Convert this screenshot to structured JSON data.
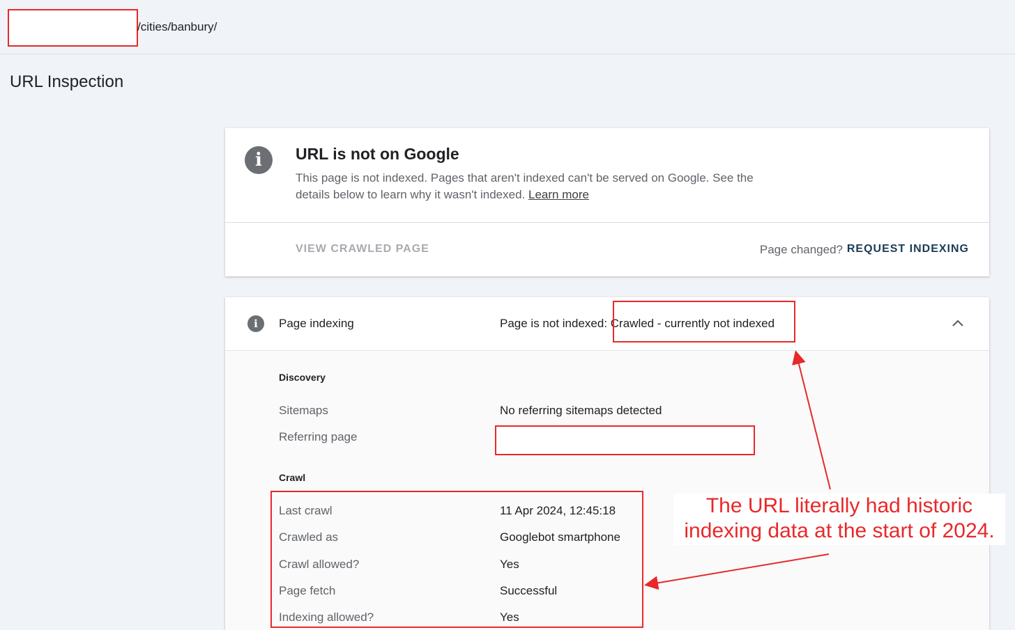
{
  "header": {
    "url_suffix": "/cities/banbury/",
    "page_title": "URL Inspection"
  },
  "status_card": {
    "info_icon": "info-icon",
    "title": "URL is not on Google",
    "description": "This page is not indexed. Pages that aren't indexed can't be served on Google. See the details below to learn why it wasn't indexed.",
    "learn_more": "Learn more",
    "view_crawled": "VIEW CRAWLED PAGE",
    "page_changed": "Page changed?",
    "request_indexing": "REQUEST INDEXING"
  },
  "indexing_card": {
    "info_icon": "info-icon",
    "label": "Page indexing",
    "status_prefix": "Page is not indexed: ",
    "status_reason": "Crawled - currently not indexed",
    "chevron_icon": "chevron-up-icon",
    "discovery": {
      "heading": "Discovery",
      "rows": [
        {
          "label": "Sitemaps",
          "value": "No referring sitemaps detected"
        },
        {
          "label": "Referring page",
          "value": ""
        }
      ]
    },
    "crawl": {
      "heading": "Crawl",
      "rows": [
        {
          "label": "Last crawl",
          "value": "11 Apr 2024, 12:45:18"
        },
        {
          "label": "Crawled as",
          "value": "Googlebot smartphone"
        },
        {
          "label": "Crawl allowed?",
          "value": "Yes"
        },
        {
          "label": "Page fetch",
          "value": "Successful"
        },
        {
          "label": "Indexing allowed?",
          "value": "Yes"
        }
      ]
    }
  },
  "annotation": {
    "line1": "The URL literally had historic",
    "line2": "indexing data at the start of 2024.",
    "color": "#e8282b"
  }
}
